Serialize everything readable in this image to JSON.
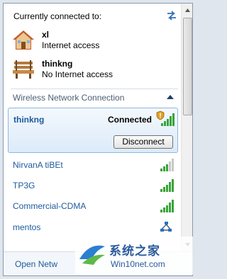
{
  "header": {
    "title": "Currently connected to:"
  },
  "connections": [
    {
      "name": "xl",
      "status": "Internet access",
      "icon": "house-icon"
    },
    {
      "name": "thinkng",
      "status": "No Internet access",
      "icon": "park-bench-icon"
    }
  ],
  "section": {
    "title": "Wireless Network Connection"
  },
  "selected_network": {
    "name": "thinkng",
    "state": "Connected",
    "button_label": "Disconnect",
    "signal_bars": 5
  },
  "networks": [
    {
      "name": "NirvanA tiBEt",
      "signal_bars": 3,
      "icon": "wifi-signal-icon"
    },
    {
      "name": "TP3G",
      "signal_bars": 5,
      "icon": "wifi-signal-icon"
    },
    {
      "name": "Commercial-CDMA",
      "signal_bars": 5,
      "icon": "wifi-signal-icon"
    },
    {
      "name": "mentos",
      "icon": "ad-hoc-network-icon"
    }
  ],
  "footer": {
    "link_label": "Open Netw"
  },
  "watermark": {
    "brand": "系统之家",
    "site": "Win10net.com"
  },
  "colors": {
    "link": "#1d5a9e",
    "signal_green": "#3aa33a",
    "selected_bg": "#dcebf9",
    "selected_border": "#8fb5dd"
  }
}
